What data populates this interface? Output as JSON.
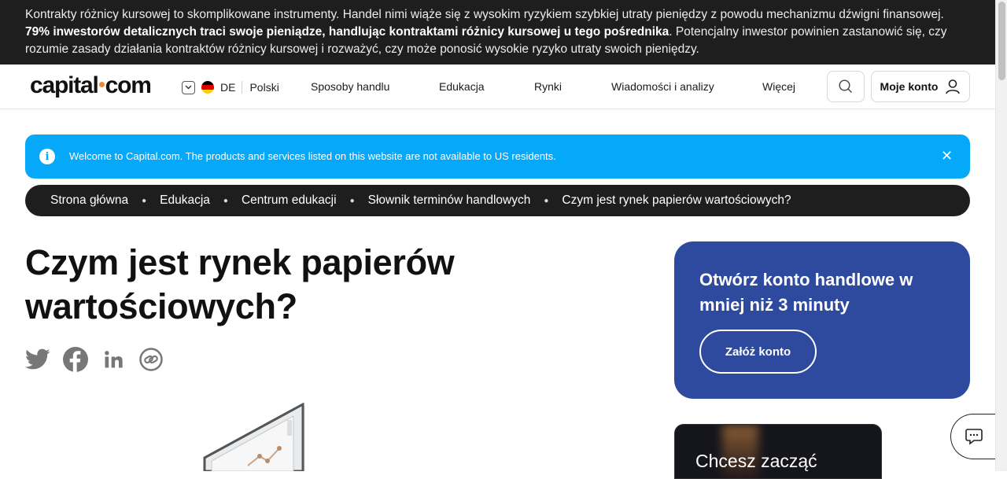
{
  "risk_banner": {
    "text_before": "Kontrakty różnicy kursowej to skomplikowane instrumenty. Handel nimi wiąże się z wysokim ryzykiem szybkiej utraty pieniędzy z powodu mechanizmu dźwigni finansowej. ",
    "text_bold": "79% inwestorów detalicznych traci swoje pieniądze, handlując kontraktami różnicy kursowej u tego pośrednika",
    "text_after": ". Potencjalny inwestor powinien zastanowić się, czy rozumie zasady działania kontraktów różnicy kursowej i rozważyć, czy może ponosić wysokie ryzyko utraty swoich pieniędzy."
  },
  "header": {
    "logo_left": "capital",
    "logo_right": "com",
    "region_code": "DE",
    "language": "Polski",
    "nav": [
      "Sposoby handlu",
      "Edukacja",
      "Rynki",
      "Wiadomości i analizy",
      "Więcej"
    ],
    "account_label": "Moje konto"
  },
  "notice": {
    "message": "Welcome to Capital.com. The products and services listed on this website are not available to US residents.",
    "close_glyph": "✕"
  },
  "breadcrumb": [
    "Strona główna",
    "Edukacja",
    "Centrum edukacji",
    "Słownik terminów handlowych",
    "Czym jest rynek papierów wartościowych?"
  ],
  "article": {
    "title": "Czym jest rynek papierów wartościowych?"
  },
  "share_icons": [
    "twitter-icon",
    "facebook-icon",
    "linkedin-icon",
    "copy-link-icon"
  ],
  "signup_card": {
    "title": "Otwórz konto handlowe w mniej niż 3 minuty",
    "button": "Załóż konto"
  },
  "promo_card": {
    "title": "Chcesz zacząć"
  },
  "colors": {
    "banner_bg": "#1e1e1e",
    "notice_bg": "#06a8f9",
    "card_bg": "#2d4a9e",
    "logo_dot": "#e88a3c"
  }
}
